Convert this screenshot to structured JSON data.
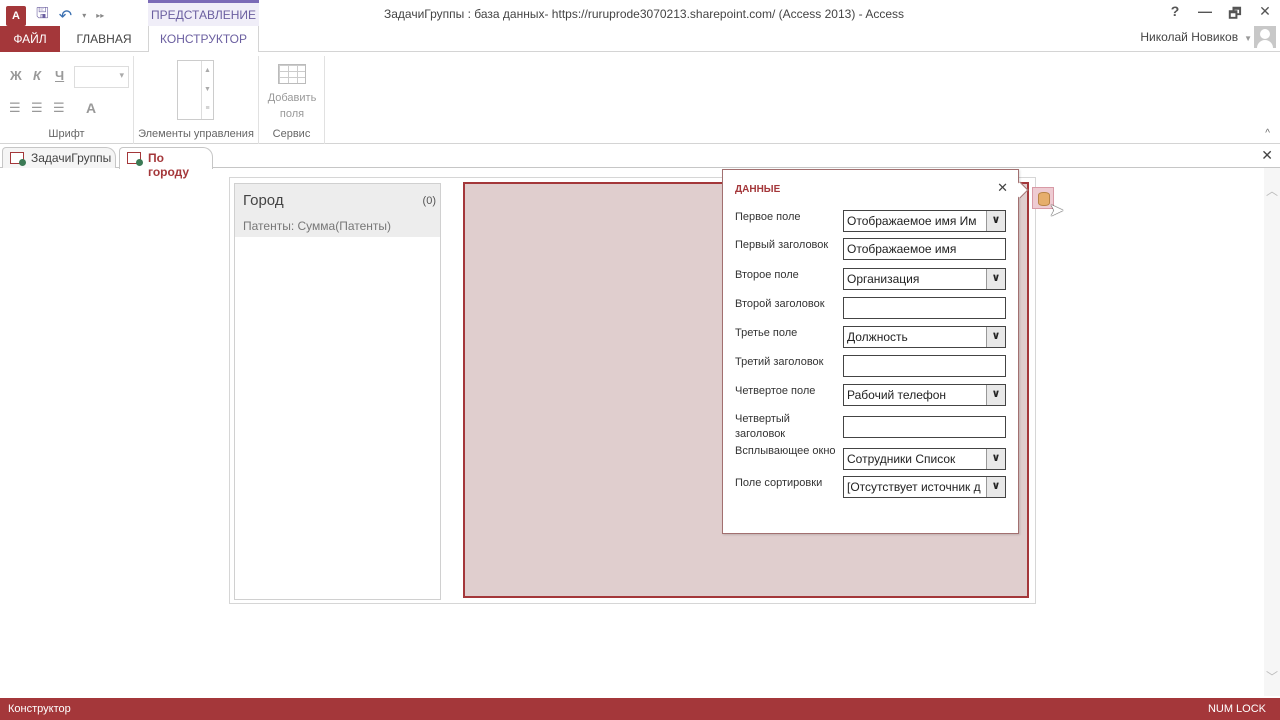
{
  "window": {
    "title": "ЗадачиГруппы : база данных- https://ruruprode3070213.sharepoint.com/ (Access 2013) - Access",
    "app_icon": "A",
    "controls": {
      "help": "?",
      "minimize": "—",
      "restore": "🗗",
      "close": "✕"
    }
  },
  "qat": {
    "save": "save-icon",
    "undo": "↶",
    "undo_caret": "▾",
    "customize": "▸▸"
  },
  "ribbon": {
    "context_tab": "ПРЕДСТАВЛЕНИЕ",
    "tabs": [
      {
        "label": "ФАЙЛ"
      },
      {
        "label": "ГЛАВНАЯ"
      },
      {
        "label": "КОНСТРУКТОР"
      }
    ],
    "user": "Николай Новиков",
    "groups": {
      "font": {
        "label": "Шрифт",
        "bold": "Ж",
        "italic": "К",
        "underline": "Ч",
        "font_color": "A"
      },
      "controls": {
        "label": "Элементы управления"
      },
      "service": {
        "label": "Сервис",
        "add_fields_line1": "Добавить",
        "add_fields_line2": "поля"
      }
    },
    "collapse": "^"
  },
  "doc_tabs": [
    {
      "label": "ЗадачиГруппы",
      "active": false
    },
    {
      "label": "По городу",
      "active": true
    }
  ],
  "doc_close": "✕",
  "list_panel": {
    "title": "Город",
    "count": "(0)",
    "subtitle": "Патенты: Сумма(Патенты)"
  },
  "popup": {
    "title": "ДАННЫЕ",
    "close": "✕",
    "rows": [
      {
        "label": "Первое поле",
        "value": "Отображаемое имя Им",
        "type": "select"
      },
      {
        "label": "Первый заголовок",
        "value": "Отображаемое имя",
        "type": "text"
      },
      {
        "label": "Второе поле",
        "value": "Организация",
        "type": "select"
      },
      {
        "label": "Второй заголовок",
        "value": "",
        "type": "text"
      },
      {
        "label": "Третье поле",
        "value": "Должность",
        "type": "select"
      },
      {
        "label": "Третий заголовок",
        "value": "",
        "type": "text"
      },
      {
        "label": "Четвертое поле",
        "value": "Рабочий телефон",
        "type": "select"
      },
      {
        "label": "Четвертый заголовок",
        "value": "",
        "type": "text"
      },
      {
        "label": "Всплывающее окно",
        "value": "Сотрудники Список",
        "type": "select"
      },
      {
        "label": "Поле сортировки",
        "value": "[Отсутствует источник д",
        "type": "select"
      }
    ]
  },
  "status": {
    "left": "Конструктор",
    "right": "NUM LOCK"
  }
}
